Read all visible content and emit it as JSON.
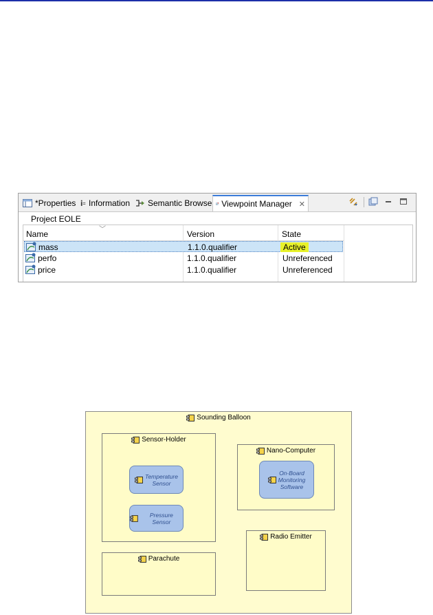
{
  "tabs": [
    {
      "label": "*Properties",
      "icon": "properties-icon"
    },
    {
      "label": "Information",
      "icon": "information-icon"
    },
    {
      "label": "Semantic Browser",
      "icon": "semantic-browser-icon"
    },
    {
      "label": "Viewpoint Manager",
      "icon": "viewpoint-manager-icon",
      "active": true
    }
  ],
  "toolbar": {
    "icons": [
      "link-icon",
      "new-view-icon",
      "minimize-icon",
      "maximize-icon"
    ]
  },
  "project_label": "Project EOLE",
  "table": {
    "columns": [
      "Name",
      "Version",
      "State"
    ],
    "rows": [
      {
        "name": "mass",
        "version": "1.1.0.qualifier",
        "state": "Active",
        "selected": true
      },
      {
        "name": "perfo",
        "version": "1.1.0.qualifier",
        "state": "Unreferenced"
      },
      {
        "name": "price",
        "version": "1.1.0.qualifier",
        "state": "Unreferenced"
      }
    ]
  },
  "diagram": {
    "root": "Sounding Balloon",
    "components": {
      "sensor_holder": "Sensor-Holder",
      "nano_computer": "Nano-Computer",
      "parachute": "Parachute",
      "radio_emitter": "Radio Emitter"
    },
    "software": {
      "temperature": [
        "Temperature",
        "Sensor"
      ],
      "pressure": "Pressure Sensor",
      "onboard": [
        "On-Board",
        "Monitoring",
        "Software"
      ]
    }
  },
  "colors": {
    "accent": "#3b7cd9",
    "selection": "#cce4f7",
    "active_highlight": "#e8f22a",
    "diagram_bg": "#fffccf",
    "software_fill": "#a9c3ea"
  }
}
